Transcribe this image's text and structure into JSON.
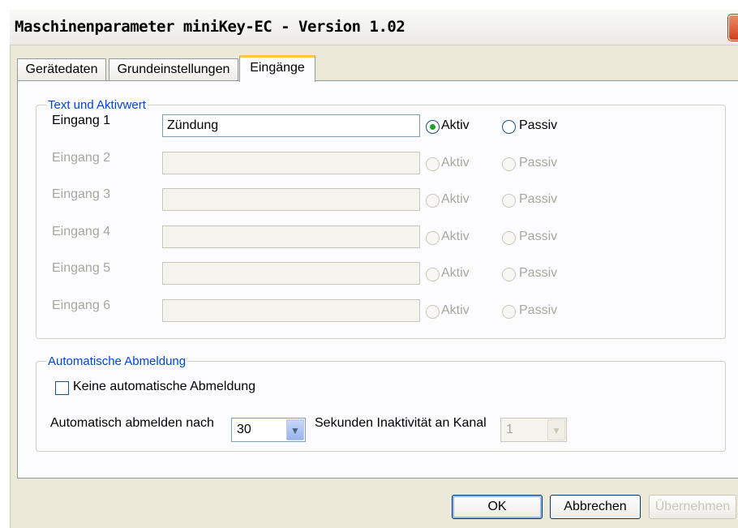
{
  "window": {
    "title": "Maschinenparameter miniKey-EC - Version 1.02",
    "close_glyph": "✕"
  },
  "tabs": [
    {
      "label": "Gerätedaten",
      "active": false
    },
    {
      "label": "Grundeinstellungen",
      "active": false
    },
    {
      "label": "Eingänge",
      "active": true
    }
  ],
  "inputs_group": {
    "legend": "Text und Aktivwert",
    "rows": [
      {
        "label": "Eingang 1",
        "value": "Zündung",
        "enabled": true,
        "aktiv_label": "Aktiv",
        "passiv_label": "Passiv",
        "selected": "Aktiv"
      },
      {
        "label": "Eingang 2",
        "value": "",
        "enabled": false,
        "aktiv_label": "Aktiv",
        "passiv_label": "Passiv",
        "selected": null
      },
      {
        "label": "Eingang 3",
        "value": "",
        "enabled": false,
        "aktiv_label": "Aktiv",
        "passiv_label": "Passiv",
        "selected": null
      },
      {
        "label": "Eingang 4",
        "value": "",
        "enabled": false,
        "aktiv_label": "Aktiv",
        "passiv_label": "Passiv",
        "selected": null
      },
      {
        "label": "Eingang 5",
        "value": "",
        "enabled": false,
        "aktiv_label": "Aktiv",
        "passiv_label": "Passiv",
        "selected": null
      },
      {
        "label": "Eingang 6",
        "value": "",
        "enabled": false,
        "aktiv_label": "Aktiv",
        "passiv_label": "Passiv",
        "selected": null
      }
    ]
  },
  "logout_group": {
    "legend": "Automatische Abmeldung",
    "checkbox_label": "Keine automatische Abmeldung",
    "checkbox_checked": false,
    "after_label": "Automatisch abmelden nach",
    "seconds_value": "30",
    "inactivity_label": "Sekunden Inaktivität an Kanal",
    "channel_value": "1"
  },
  "buttons": {
    "ok": "OK",
    "cancel": "Abbrechen",
    "apply": "Übernehmen"
  },
  "colors": {
    "dialog_bg": "#ece9d8",
    "legend_blue": "#0046d5",
    "radio_selected": "#21a121",
    "tab_highlight": "#ffc83c"
  },
  "icons": {
    "dropdown": "chevron-down-icon",
    "close": "close-icon"
  }
}
